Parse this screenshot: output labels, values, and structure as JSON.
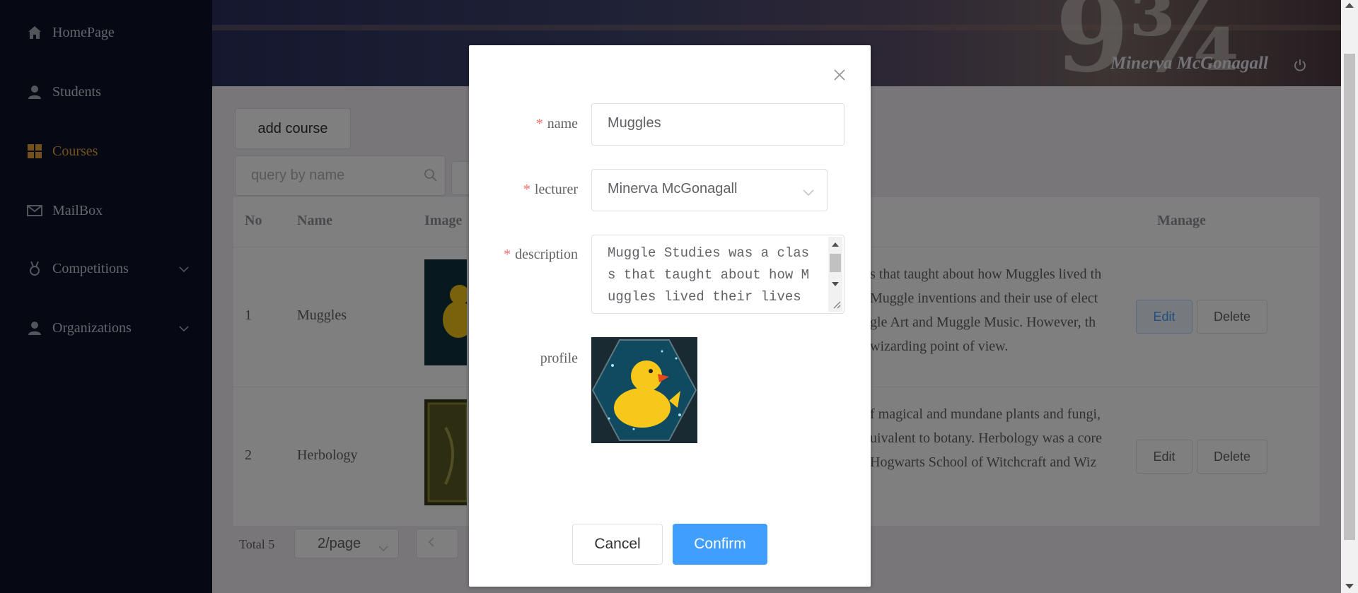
{
  "sidebar": {
    "items": [
      {
        "label": "HomePage",
        "icon": "home-icon"
      },
      {
        "label": "Students",
        "icon": "user-icon"
      },
      {
        "label": "Courses",
        "icon": "grid-icon"
      },
      {
        "label": "MailBox",
        "icon": "mail-icon"
      },
      {
        "label": "Competitions",
        "icon": "medal-icon"
      },
      {
        "label": "Organizations",
        "icon": "people-icon"
      }
    ],
    "active": "Courses",
    "active_color": "#e7a23a"
  },
  "header": {
    "user_name": "Minerva McGonagall"
  },
  "toolbar": {
    "add_label": "add course",
    "search_placeholder": "query by name"
  },
  "table": {
    "columns": [
      "No",
      "Name",
      "Image",
      "Manage"
    ],
    "rows": [
      {
        "no": "1",
        "name": "Muggles",
        "desc_lines": [
          "s that taught about how Muggles lived th",
          "Muggle inventions and their use of elect",
          "gle Art and Muggle Music. However, th",
          "wizarding point of view."
        ]
      },
      {
        "no": "2",
        "name": "Herbology",
        "desc_lines": [
          "f magical and mundane plants and fungi,",
          "uivalent to botany. Herbology was a core",
          "Hogwarts School of Witchcraft and Wiz"
        ]
      }
    ],
    "edit_label": "Edit",
    "delete_label": "Delete"
  },
  "pagination": {
    "total": "Total 5",
    "page_size": "2/page"
  },
  "dialog": {
    "name_label": "name",
    "name_value": "Muggles",
    "lecturer_label": "lecturer",
    "lecturer_value": "Minerva McGonagall",
    "description_label": "description",
    "description_value": "Muggle Studies was a class that taught about how Muggles lived their lives",
    "profile_label": "profile",
    "cancel_label": "Cancel",
    "confirm_label": "Confirm",
    "confirm_color": "#409eff",
    "required_color": "#f56c6c"
  }
}
